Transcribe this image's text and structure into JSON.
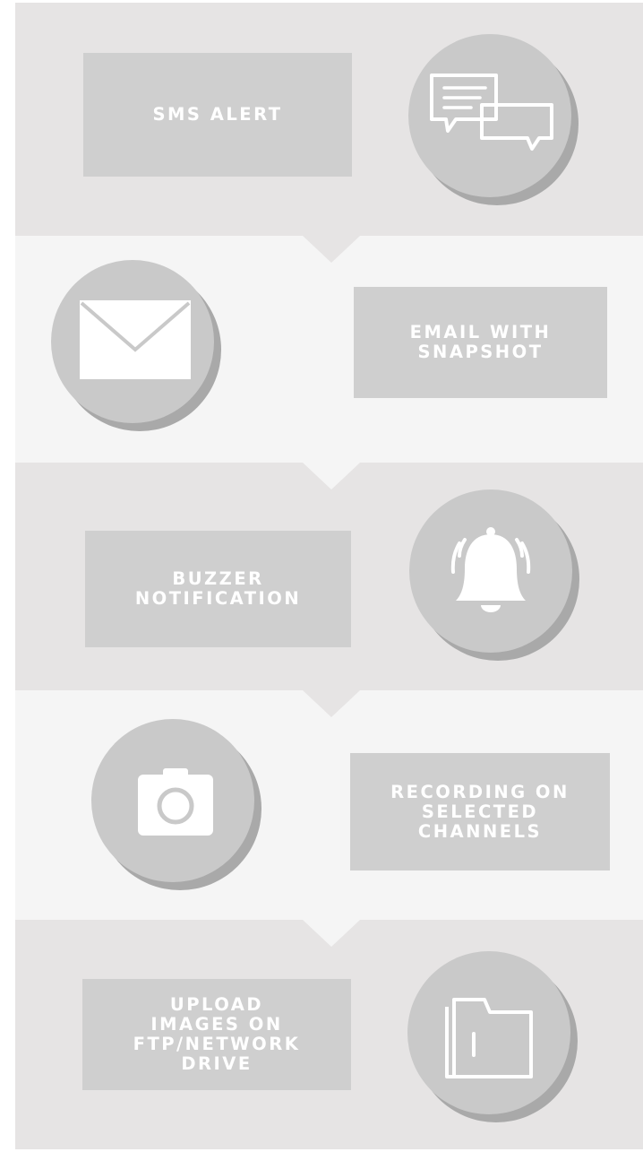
{
  "colors": {
    "band_dark": "#e6e4e4",
    "band_light": "#f5f5f5",
    "label_box": "#cfcfcf",
    "circle": "#c9c9c9",
    "circle_shadow": "#a9a9a9",
    "text": "#ffffff"
  },
  "steps": [
    {
      "label_lines": [
        "SMS ALERT"
      ],
      "icon": "sms-chat-bubbles-icon"
    },
    {
      "label_lines": [
        "EMAIL WITH",
        "SNAPSHOT"
      ],
      "icon": "envelope-icon"
    },
    {
      "label_lines": [
        "BUZZER",
        "NOTIFICATION"
      ],
      "icon": "ringing-bell-icon"
    },
    {
      "label_lines": [
        "RECORDING ON",
        "SELECTED",
        "CHANNELS"
      ],
      "icon": "camera-icon"
    },
    {
      "label_lines": [
        "UPLOAD",
        "IMAGES ON",
        "FTP/NETWORK",
        "DRIVE"
      ],
      "icon": "folder-icon"
    }
  ]
}
